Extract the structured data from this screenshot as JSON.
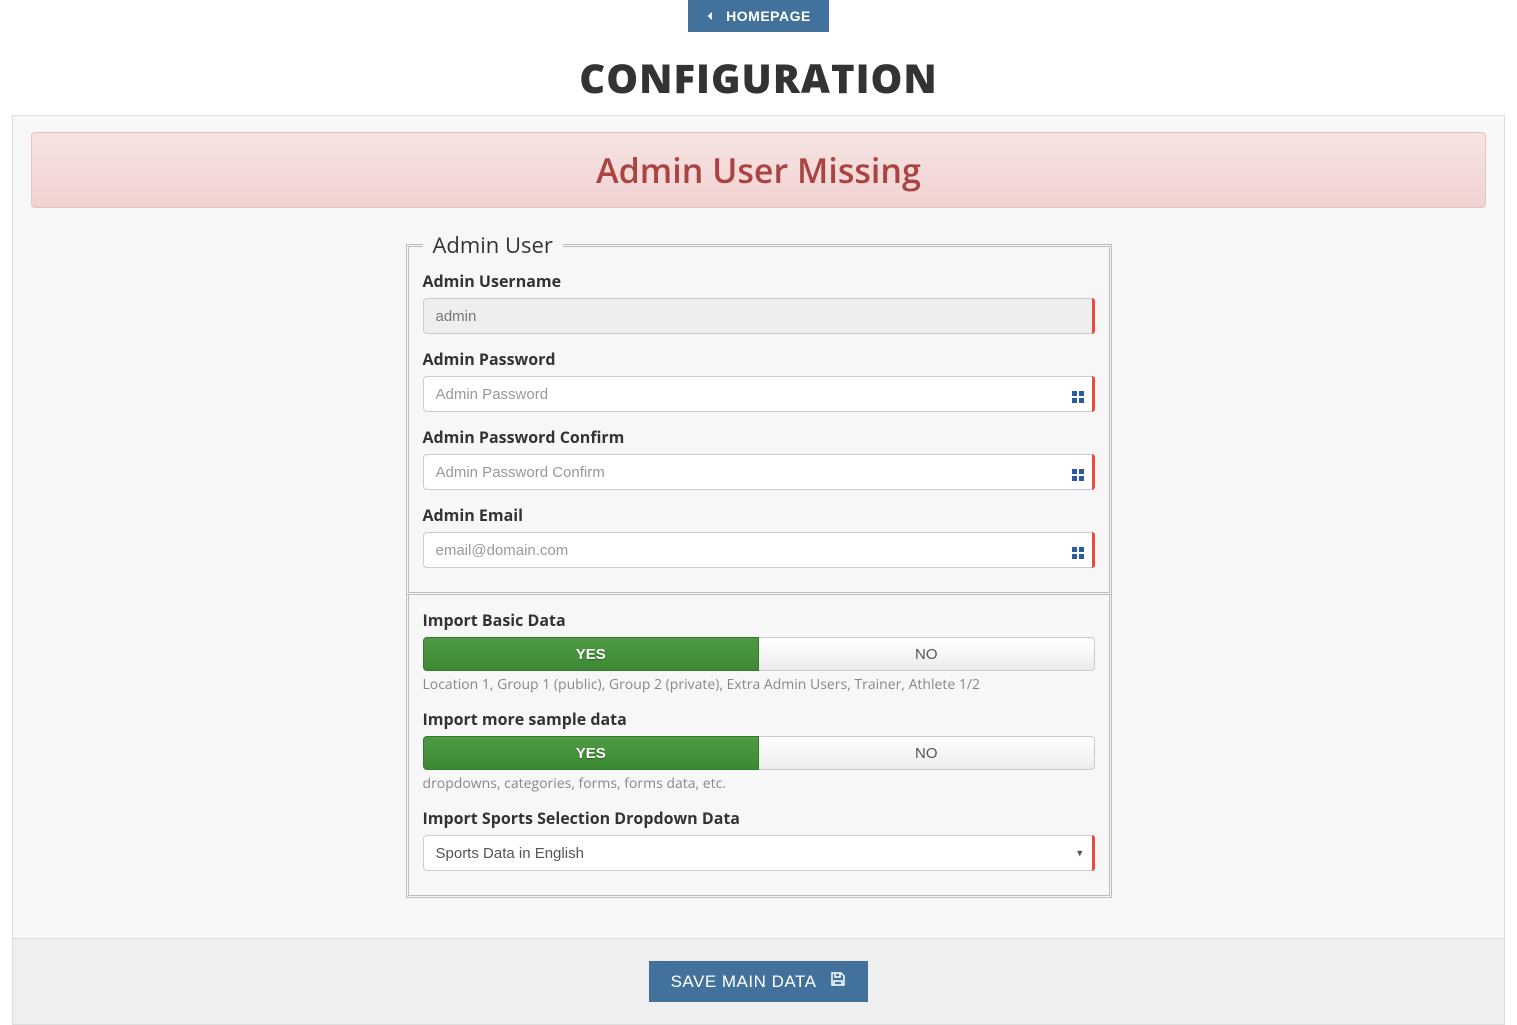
{
  "header": {
    "homepage_label": "HOMEPAGE",
    "page_title": "CONFIGURATION"
  },
  "alert": {
    "text": "Admin User Missing"
  },
  "admin_user": {
    "legend": "Admin User",
    "username_label": "Admin Username",
    "username_value": "admin",
    "password_label": "Admin Password",
    "password_placeholder": "Admin Password",
    "password_confirm_label": "Admin Password Confirm",
    "password_confirm_placeholder": "Admin Password Confirm",
    "email_label": "Admin Email",
    "email_placeholder": "email@domain.com"
  },
  "imports": {
    "basic_label": "Import Basic Data",
    "basic_yes": "YES",
    "basic_no": "NO",
    "basic_help": "Location 1, Group 1 (public), Group 2 (private), Extra Admin Users, Trainer, Athlete 1/2",
    "sample_label": "Import more sample data",
    "sample_yes": "YES",
    "sample_no": "NO",
    "sample_help": "dropdowns, categories, forms, forms data, etc.",
    "sports_label": "Import Sports Selection Dropdown Data",
    "sports_selected": "Sports Data in English"
  },
  "footer": {
    "save_label": "SAVE MAIN DATA"
  }
}
